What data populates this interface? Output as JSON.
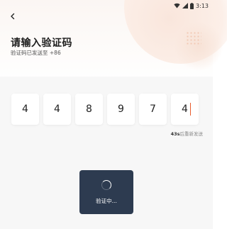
{
  "status_bar": {
    "time": "3:13",
    "icons": [
      "wifi-icon",
      "signal-icon",
      "battery-icon"
    ]
  },
  "nav": {
    "back_icon": "chevron-left-icon"
  },
  "header": {
    "title": "请输入验证码",
    "subtitle": "验证码已发送至 +86"
  },
  "code_input": {
    "digits": [
      "4",
      "4",
      "8",
      "9",
      "7",
      "4"
    ],
    "active_index": 5,
    "cursor_color": "#e85c2e"
  },
  "resend": {
    "seconds": "43s",
    "text": "后重新发送"
  },
  "toast": {
    "icon": "spinner-icon",
    "text": "验证中..."
  },
  "colors": {
    "accent": "#e85c2e",
    "toast_bg": "#2d3b50",
    "panel_bg": "#f7f7f7"
  }
}
